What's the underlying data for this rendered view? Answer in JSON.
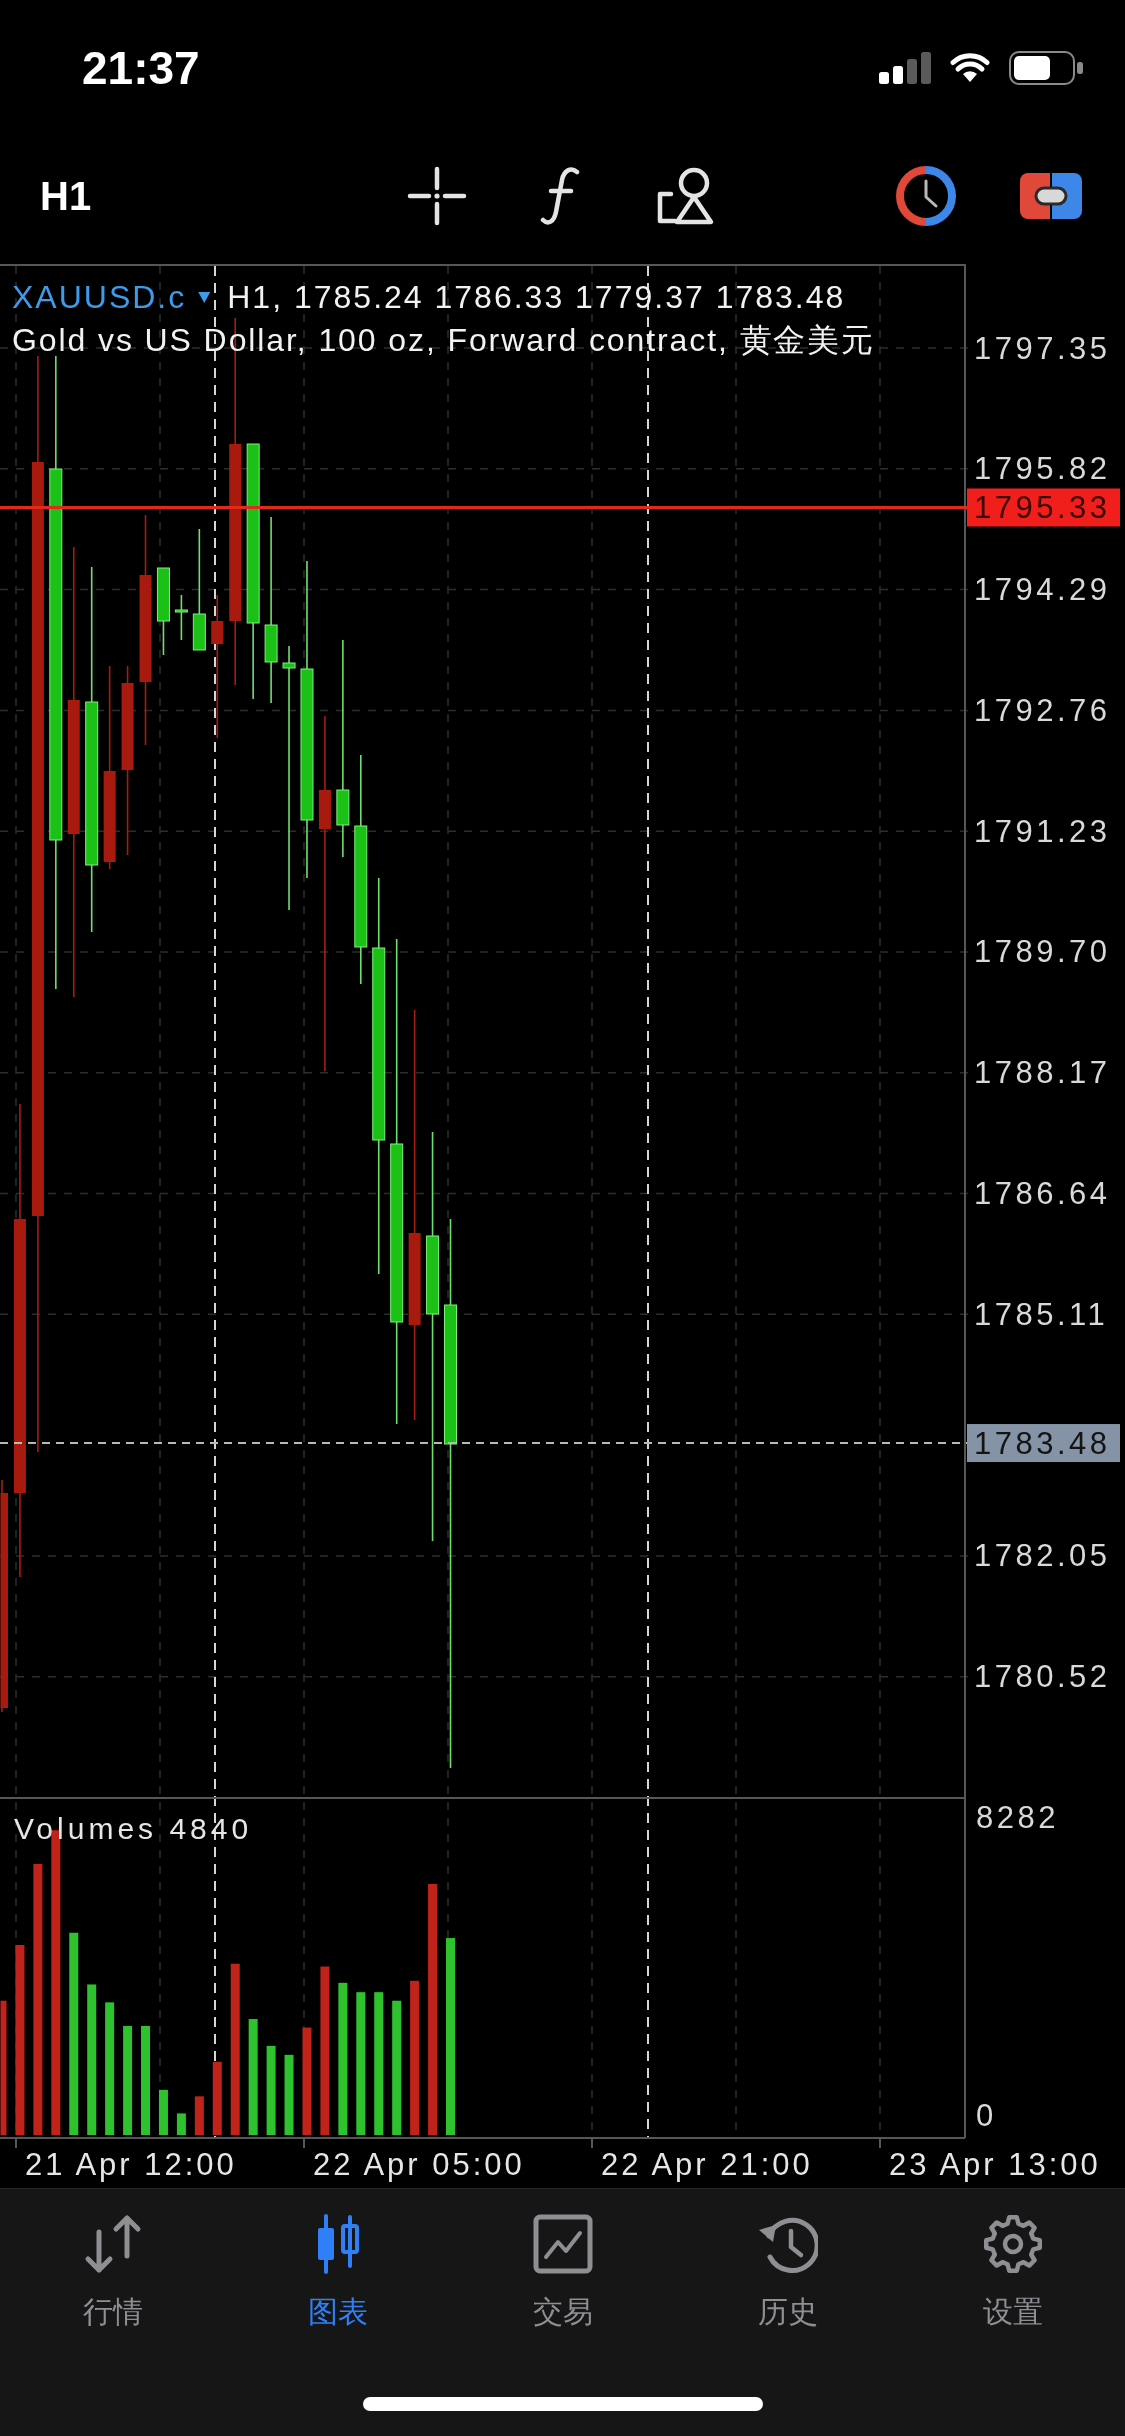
{
  "status_bar": {
    "time": "21:37"
  },
  "toolbar": {
    "timeframe": "H1"
  },
  "chart": {
    "symbol": "XAUUSD.c",
    "readout": "H1, 1785.24 1786.33 1779.37 1783.48",
    "description": "Gold vs US Dollar, 100 oz, Forward contract, 黄金美元",
    "price_axis": [
      "1797.35",
      "1795.82",
      "1794.29",
      "1792.76",
      "1791.23",
      "1789.70",
      "1788.17",
      "1786.64",
      "1785.11",
      "1782.05",
      "1780.52"
    ],
    "price_lines": [
      {
        "kind": "level",
        "label": "1795.33"
      },
      {
        "kind": "bid",
        "label": "1783.48"
      }
    ]
  },
  "volume": {
    "title": "Volumes 4840",
    "axis": [
      "8282",
      "0"
    ]
  },
  "time_axis": [
    "21 Apr 12:00",
    "22 Apr 05:00",
    "22 Apr 21:00",
    "23 Apr 13:00"
  ],
  "nav": [
    {
      "label": "行情",
      "selected": false
    },
    {
      "label": "图表",
      "selected": true
    },
    {
      "label": "交易",
      "selected": false
    },
    {
      "label": "历史",
      "selected": false
    },
    {
      "label": "设置",
      "selected": false
    }
  ]
}
